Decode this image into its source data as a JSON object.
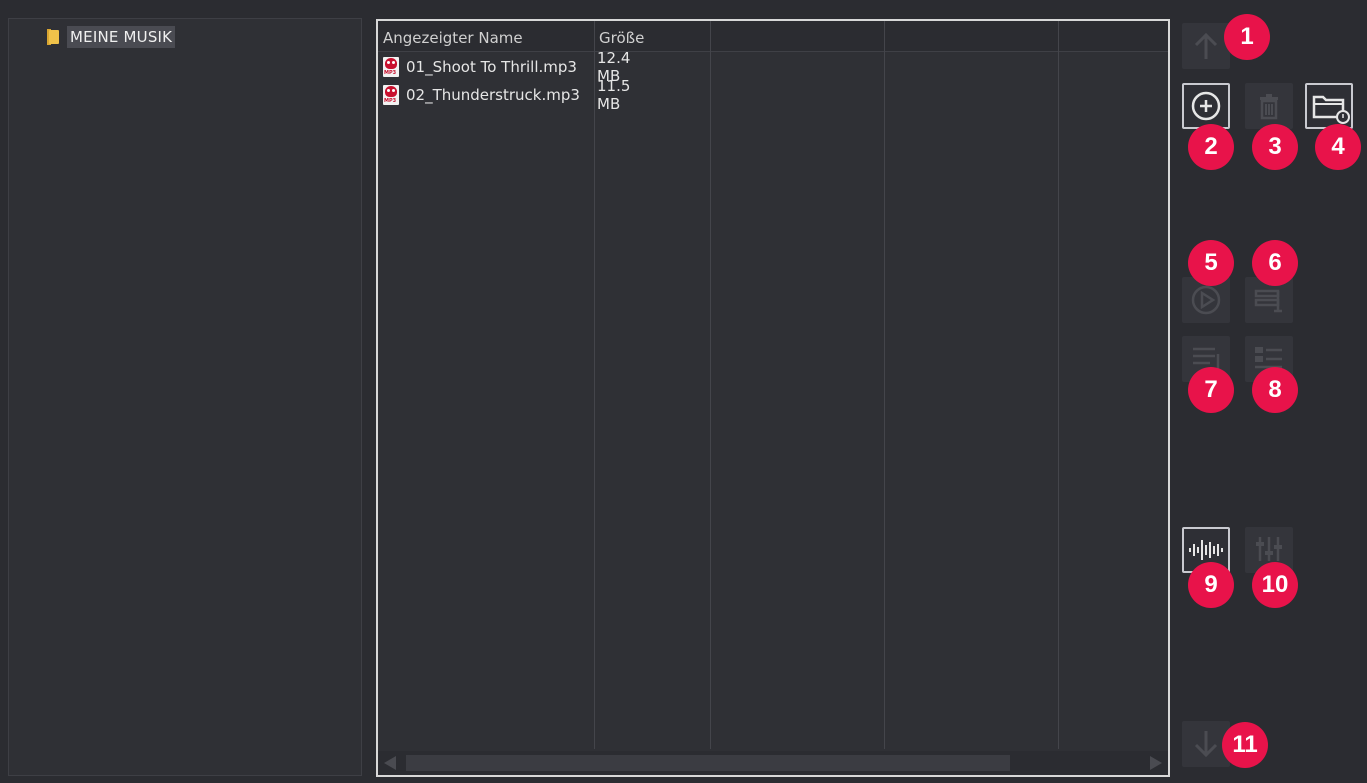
{
  "tree": {
    "root_label": "MEINE MUSIK"
  },
  "file_list": {
    "columns": [
      "Angezeigter Name",
      "Größe",
      "",
      "",
      ""
    ],
    "rows": [
      {
        "name": "01_Shoot To Thrill.mp3",
        "size": "12.4 MB",
        "icon": "mp3-file-icon"
      },
      {
        "name": "02_Thunderstruck.mp3",
        "size": "11.5 MB",
        "icon": "mp3-file-icon"
      }
    ],
    "icon_tag": "MP3"
  },
  "toolbar": {
    "buttons": [
      {
        "id": "move-up",
        "icon": "arrow-up-icon",
        "enabled": false
      },
      {
        "id": "add",
        "icon": "add-circle-icon",
        "enabled": true
      },
      {
        "id": "delete",
        "icon": "trash-icon",
        "enabled": false
      },
      {
        "id": "open-folder",
        "icon": "folder-search-icon",
        "enabled": true
      },
      {
        "id": "play",
        "icon": "play-circle-icon",
        "enabled": false
      },
      {
        "id": "edit-text",
        "icon": "edit-text-icon",
        "enabled": false
      },
      {
        "id": "list",
        "icon": "list-icon",
        "enabled": false
      },
      {
        "id": "list-numbered",
        "icon": "list-numbered-icon",
        "enabled": false
      },
      {
        "id": "waveform",
        "icon": "waveform-icon",
        "enabled": true
      },
      {
        "id": "mixer",
        "icon": "mixer-sliders-icon",
        "enabled": false
      },
      {
        "id": "move-down",
        "icon": "arrow-down-icon",
        "enabled": false
      }
    ]
  },
  "badges": [
    "1",
    "2",
    "3",
    "4",
    "5",
    "6",
    "7",
    "8",
    "9",
    "10",
    "11"
  ],
  "colors": {
    "badge": "#e8134a",
    "background": "#2b2c31",
    "panel": "#2f3035",
    "selection": "#4a4b52",
    "folder": "#f0c24a"
  }
}
